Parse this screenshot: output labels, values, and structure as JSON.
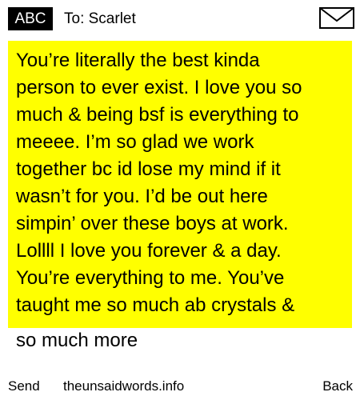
{
  "header": {
    "mode": "ABC",
    "recipient": "To: Scarlet",
    "icon": "envelope-icon"
  },
  "message": {
    "highlight_color": "#ffff00",
    "lines": [
      "You’re literally the best kinda",
      "person to ever exist. I love you so",
      "much & being bsf is everything to",
      "meeee. I’m so glad we work",
      "together bc id lose my mind if it",
      "wasn’t for you. I’d be out here",
      "simpin’ over these boys at work.",
      "Lollll I love you forever & a day.",
      "You’re everything to me. You’ve",
      "taught me so much ab crystals &",
      "so much more"
    ]
  },
  "footer": {
    "send_label": "Send",
    "site": "theunsaidwords.info",
    "back_label": "Back"
  }
}
